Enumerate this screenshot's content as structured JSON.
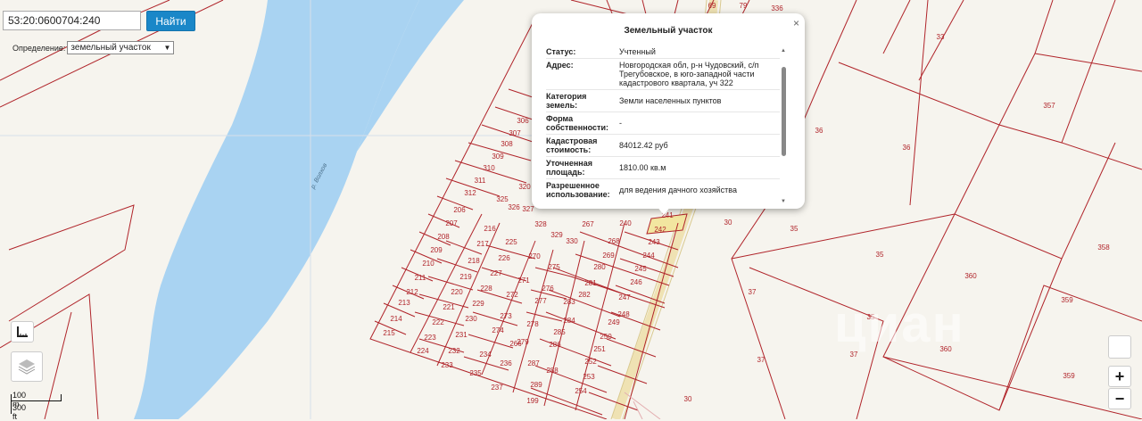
{
  "search": {
    "value": "53:20:0600704:240",
    "button_label": "Найти"
  },
  "definition": {
    "label": "Определение:",
    "selected": "земельный участок"
  },
  "popup": {
    "title": "Земельный участок",
    "close_symbol": "×",
    "rows": [
      {
        "key": "Статус:",
        "value": "Учтенный"
      },
      {
        "key": "Адрес:",
        "value": "Новгородская обл, р-н Чудовский, с/п Трегубовское, в юго-западной части кадастрового квартала, уч 322"
      },
      {
        "key": "Категория земель:",
        "value": "Земли населенных пунктов"
      },
      {
        "key": "Форма собственности:",
        "value": "-"
      },
      {
        "key": "Кадастровая стоимость:",
        "value": "84012.42 руб"
      },
      {
        "key": "Уточненная площадь:",
        "value": "1810.00 кв.м"
      },
      {
        "key": "Разрешенное использование:",
        "value": "для ведения дачного хозяйства"
      }
    ]
  },
  "river_label": "р. Волхов",
  "scale": {
    "metric": "100 m",
    "imperial": "300 ft"
  },
  "zoom": {
    "in": "+",
    "out": "−"
  },
  "watermark": "циан",
  "parcels": [
    {
      "n": "69"
    },
    {
      "n": "79"
    },
    {
      "n": "336"
    },
    {
      "n": "33"
    },
    {
      "n": "357"
    },
    {
      "n": "36"
    },
    {
      "n": "36"
    },
    {
      "n": "358"
    },
    {
      "n": "35"
    },
    {
      "n": "35"
    },
    {
      "n": "30"
    },
    {
      "n": "360"
    },
    {
      "n": "359"
    },
    {
      "n": "37"
    },
    {
      "n": "37"
    },
    {
      "n": "37"
    },
    {
      "n": "35"
    },
    {
      "n": "360"
    },
    {
      "n": "359"
    },
    {
      "n": "30"
    },
    {
      "n": "306"
    },
    {
      "n": "307"
    },
    {
      "n": "308"
    },
    {
      "n": "309"
    },
    {
      "n": "310"
    },
    {
      "n": "311"
    },
    {
      "n": "312"
    },
    {
      "n": "320"
    },
    {
      "n": "325"
    },
    {
      "n": "326"
    },
    {
      "n": "327"
    },
    {
      "n": "328"
    },
    {
      "n": "329"
    },
    {
      "n": "330"
    },
    {
      "n": "206"
    },
    {
      "n": "207"
    },
    {
      "n": "208"
    },
    {
      "n": "209"
    },
    {
      "n": "210"
    },
    {
      "n": "211"
    },
    {
      "n": "212"
    },
    {
      "n": "213"
    },
    {
      "n": "214"
    },
    {
      "n": "215"
    },
    {
      "n": "216"
    },
    {
      "n": "217"
    },
    {
      "n": "218"
    },
    {
      "n": "219"
    },
    {
      "n": "220"
    },
    {
      "n": "221"
    },
    {
      "n": "222"
    },
    {
      "n": "223"
    },
    {
      "n": "224"
    },
    {
      "n": "225"
    },
    {
      "n": "226"
    },
    {
      "n": "227"
    },
    {
      "n": "228"
    },
    {
      "n": "229"
    },
    {
      "n": "230"
    },
    {
      "n": "231"
    },
    {
      "n": "232"
    },
    {
      "n": "233"
    },
    {
      "n": "234"
    },
    {
      "n": "235"
    },
    {
      "n": "236"
    },
    {
      "n": "237"
    },
    {
      "n": "270"
    },
    {
      "n": "271"
    },
    {
      "n": "272"
    },
    {
      "n": "273"
    },
    {
      "n": "274"
    },
    {
      "n": "275"
    },
    {
      "n": "276"
    },
    {
      "n": "277"
    },
    {
      "n": "278"
    },
    {
      "n": "279"
    },
    {
      "n": "266"
    },
    {
      "n": "267"
    },
    {
      "n": "268"
    },
    {
      "n": "269"
    },
    {
      "n": "280"
    },
    {
      "n": "281"
    },
    {
      "n": "282"
    },
    {
      "n": "283"
    },
    {
      "n": "284"
    },
    {
      "n": "285"
    },
    {
      "n": "286"
    },
    {
      "n": "287"
    },
    {
      "n": "288"
    },
    {
      "n": "289"
    },
    {
      "n": "199"
    },
    {
      "n": "240"
    },
    {
      "n": "241"
    },
    {
      "n": "242"
    },
    {
      "n": "243"
    },
    {
      "n": "244"
    },
    {
      "n": "245"
    },
    {
      "n": "246"
    },
    {
      "n": "247"
    },
    {
      "n": "248"
    },
    {
      "n": "249"
    },
    {
      "n": "250"
    },
    {
      "n": "251"
    },
    {
      "n": "252"
    },
    {
      "n": "253"
    },
    {
      "n": "254"
    }
  ]
}
